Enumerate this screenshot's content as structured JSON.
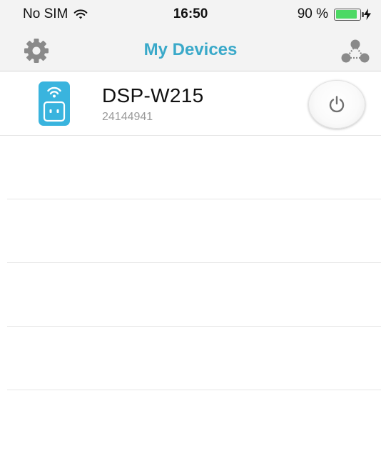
{
  "status_bar": {
    "carrier": "No SIM",
    "time": "16:50",
    "battery_text": "90 %",
    "battery_level": 0.9,
    "wifi_icon": "wifi-icon",
    "charging_icon": "bolt-icon"
  },
  "nav_bar": {
    "title": "My Devices",
    "left_icon": "gear-icon",
    "right_icon": "network-icon"
  },
  "devices": [
    {
      "name": "DSP-W215",
      "id": "24144941",
      "icon": "smart-plug-icon",
      "action_icon": "power-icon"
    }
  ],
  "empty_rows": 4,
  "colors": {
    "accent": "#3aa9c9",
    "plug": "#39b4de",
    "battery": "#4cd964",
    "icon_gray": "#8a8a8a"
  }
}
